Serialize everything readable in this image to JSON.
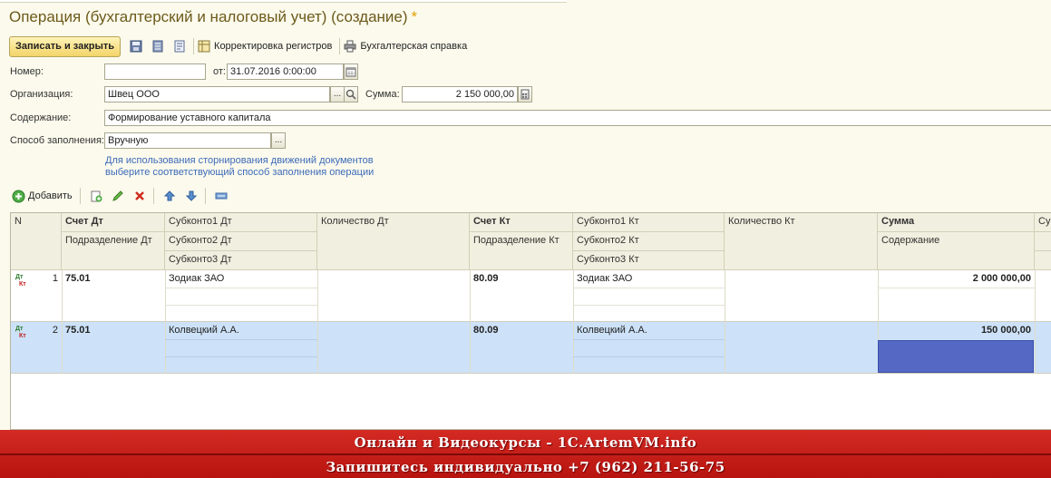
{
  "window": {
    "title": "Операция (бухгалтерский и налоговый учет) (создание)",
    "modified_mark": "*"
  },
  "toolbar": {
    "save_close_label": "Записать и закрыть",
    "registers_label": "Корректировка регистров",
    "report_label": "Бухгалтерская справка"
  },
  "form": {
    "number_label": "Номер:",
    "number_value": "",
    "date_label": "от:",
    "date_value": "31.07.2016  0:00:00",
    "org_label": "Организация:",
    "org_value": "Швец ООО",
    "sum_label": "Сумма:",
    "sum_value": "2 150 000,00",
    "content_label": "Содержание:",
    "content_value": "Формирование уставного капитала",
    "fill_label": "Способ заполнения:",
    "fill_value": "Вручную",
    "hint_line1": "Для использования сторнирования движений документов",
    "hint_line2": "выберите соответствующий способ заполнения операции"
  },
  "table_toolbar": {
    "add_label": "Добавить"
  },
  "table": {
    "headers": {
      "n": "N",
      "acc_dt": "Счет Дт",
      "sub1_dt": "Субконто1 Дт",
      "qty_dt": "Количество Дт",
      "acc_kt": "Счет Кт",
      "sub1_kt": "Субконто1 Кт",
      "qty_kt": "Количество Кт",
      "sum": "Сумма",
      "div_dt": "Подразделение Дт",
      "sub2_dt": "Субконто2 Дт",
      "div_kt": "Подразделение Кт",
      "sub2_kt": "Субконто2 Кт",
      "content": "Содержание",
      "sub3_dt": "Субконто3 Дт",
      "sub3_kt": "Субконто3 Кт",
      "more": "Су"
    },
    "rows": [
      {
        "n": "1",
        "acc_dt": "75.01",
        "sub1_dt": "Зодиак ЗАО",
        "acc_kt": "80.09",
        "sub1_kt": "Зодиак ЗАО",
        "sum": "2 000 000,00"
      },
      {
        "n": "2",
        "acc_dt": "75.01",
        "sub1_dt": "Колвецкий А.А.",
        "acc_kt": "80.09",
        "sub1_kt": "Колвецкий А.А.",
        "sum": "150 000,00"
      }
    ],
    "dt_label": "Дт",
    "kt_label": "Кт"
  },
  "banner": {
    "line1": "Онлайн и Видеокурсы - 1С.ArtemVM.info",
    "line2": "Запишитесь индивидуально +7 (962) 211-56-75"
  },
  "colors": {
    "title": "#6d5a1a",
    "hint": "#3d6ab8",
    "selected_row": "#cde2f8",
    "active_cell": "#5468c4",
    "banner": "#c81e19"
  }
}
